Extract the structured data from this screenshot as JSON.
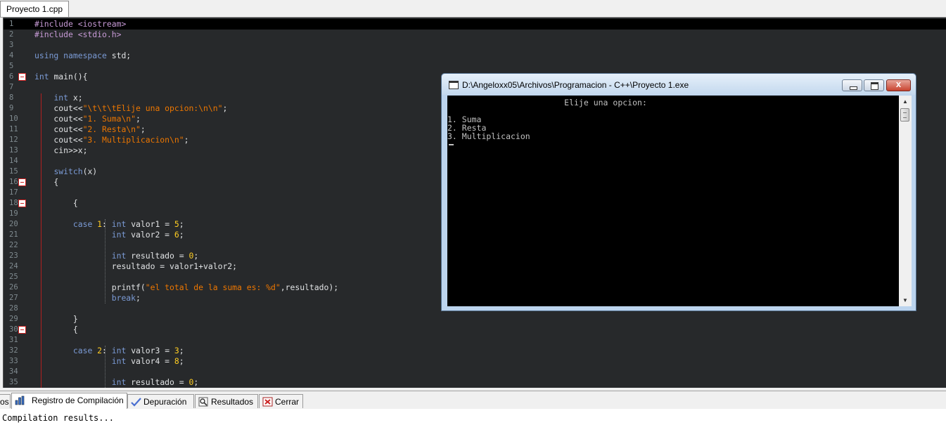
{
  "file_tab": "Proyecto 1.cpp",
  "editor": {
    "line_numbers": [
      "1",
      "2",
      "3",
      "4",
      "5",
      "6",
      "7",
      "8",
      "9",
      "10",
      "11",
      "12",
      "13",
      "14",
      "15",
      "16",
      "17",
      "18",
      "19",
      "20",
      "21",
      "22",
      "23",
      "24",
      "25",
      "26",
      "27",
      "28",
      "29",
      "30",
      "31",
      "32",
      "33",
      "34",
      "35"
    ],
    "lines": [
      [
        [
          "pp",
          "#include <iostream>"
        ]
      ],
      [
        [
          "pp",
          "#include <stdio.h>"
        ]
      ],
      [],
      [
        [
          "kw",
          "using namespace "
        ],
        [
          "fn",
          "std;"
        ]
      ],
      [],
      [
        [
          "kw",
          "int "
        ],
        [
          "fn",
          "main(){"
        ]
      ],
      [],
      [
        [
          "fn",
          "    "
        ],
        [
          "kw",
          "int "
        ],
        [
          "fn",
          "x;"
        ]
      ],
      [
        [
          "fn",
          "    cout<<"
        ],
        [
          "str",
          "\"\\t\\t\\tElije una opcion:\\n\\n\""
        ],
        [
          "fn",
          ";"
        ]
      ],
      [
        [
          "fn",
          "    cout<<"
        ],
        [
          "str",
          "\"1. Suma\\n\""
        ],
        [
          "fn",
          ";"
        ]
      ],
      [
        [
          "fn",
          "    cout<<"
        ],
        [
          "str",
          "\"2. Resta\\n\""
        ],
        [
          "fn",
          ";"
        ]
      ],
      [
        [
          "fn",
          "    cout<<"
        ],
        [
          "str",
          "\"3. Multiplicacion\\n\""
        ],
        [
          "fn",
          ";"
        ]
      ],
      [
        [
          "fn",
          "    cin>>x;"
        ]
      ],
      [],
      [
        [
          "fn",
          "    "
        ],
        [
          "kw",
          "switch"
        ],
        [
          "fn",
          "(x)"
        ]
      ],
      [
        [
          "fn",
          "    {"
        ]
      ],
      [],
      [
        [
          "fn",
          "        {"
        ]
      ],
      [],
      [
        [
          "fn",
          "        "
        ],
        [
          "kw",
          "case "
        ],
        [
          "num",
          "1"
        ],
        [
          "fn",
          ": "
        ],
        [
          "kw",
          "int "
        ],
        [
          "fn",
          "valor1 = "
        ],
        [
          "num",
          "5"
        ],
        [
          "fn",
          ";"
        ]
      ],
      [
        [
          "fn",
          "                "
        ],
        [
          "kw",
          "int "
        ],
        [
          "fn",
          "valor2 = "
        ],
        [
          "num",
          "6"
        ],
        [
          "fn",
          ";"
        ]
      ],
      [],
      [
        [
          "fn",
          "                "
        ],
        [
          "kw",
          "int "
        ],
        [
          "fn",
          "resultado = "
        ],
        [
          "num",
          "0"
        ],
        [
          "fn",
          ";"
        ]
      ],
      [
        [
          "fn",
          "                resultado = valor1+valor2;"
        ]
      ],
      [],
      [
        [
          "fn",
          "                printf("
        ],
        [
          "str",
          "\"el total de la suma es: %d\""
        ],
        [
          "fn",
          ",resultado);"
        ]
      ],
      [
        [
          "fn",
          "                "
        ],
        [
          "kw",
          "break"
        ],
        [
          "fn",
          ";"
        ]
      ],
      [],
      [
        [
          "fn",
          "        }"
        ]
      ],
      [
        [
          "fn",
          "        {"
        ]
      ],
      [],
      [
        [
          "fn",
          "        "
        ],
        [
          "kw",
          "case "
        ],
        [
          "num",
          "2"
        ],
        [
          "fn",
          ": "
        ],
        [
          "kw",
          "int "
        ],
        [
          "fn",
          "valor3 = "
        ],
        [
          "num",
          "3"
        ],
        [
          "fn",
          ";"
        ]
      ],
      [
        [
          "fn",
          "                "
        ],
        [
          "kw",
          "int "
        ],
        [
          "fn",
          "valor4 = "
        ],
        [
          "num",
          "8"
        ],
        [
          "fn",
          ";"
        ]
      ],
      [],
      [
        [
          "fn",
          "                "
        ],
        [
          "kw",
          "int "
        ],
        [
          "fn",
          "resultado = "
        ],
        [
          "num",
          "0"
        ],
        [
          "fn",
          ";"
        ]
      ]
    ],
    "fold_lines": [
      6,
      16,
      18,
      30
    ]
  },
  "console": {
    "title": "D:\\Angeloxx05\\Archivos\\Programacion - C++\\Proyecto 1.exe",
    "lines": [
      "                        Elije una opcion:",
      "",
      "1. Suma",
      "2. Resta",
      "3. Multiplicacion"
    ],
    "close_glyph": "x"
  },
  "bottom_tabs": [
    {
      "label": "os",
      "icon": "none"
    },
    {
      "label": "Registro de Compilación",
      "icon": "chart-icon"
    },
    {
      "label": "Depuración",
      "icon": "check-icon"
    },
    {
      "label": "Resultados",
      "icon": "search-icon"
    },
    {
      "label": "Cerrar",
      "icon": "close-icon"
    }
  ],
  "output_text": "Compilation results..."
}
